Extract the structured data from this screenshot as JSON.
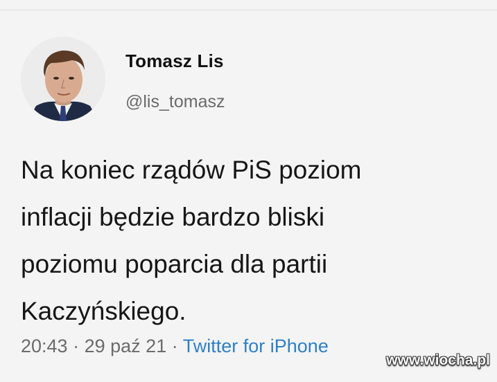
{
  "author": {
    "display_name": "Tomasz Lis",
    "handle": "@lis_tomasz",
    "avatar_icon": "profile-photo"
  },
  "tweet": {
    "lines": [
      "Na koniec rządów PiS poziom",
      "inflacji będzie bardzo bliski",
      "poziomu poparcia dla partii",
      "Kaczyńskiego."
    ]
  },
  "meta": {
    "time": "20:43",
    "separator": "·",
    "date": "29 paź 21",
    "source": "Twitter for iPhone"
  },
  "watermark": "www.wiocha.pl",
  "colors": {
    "background": "#f4f4f4",
    "text": "#161616",
    "secondary_text": "#6b6b6b",
    "link": "#2f7fc6"
  }
}
